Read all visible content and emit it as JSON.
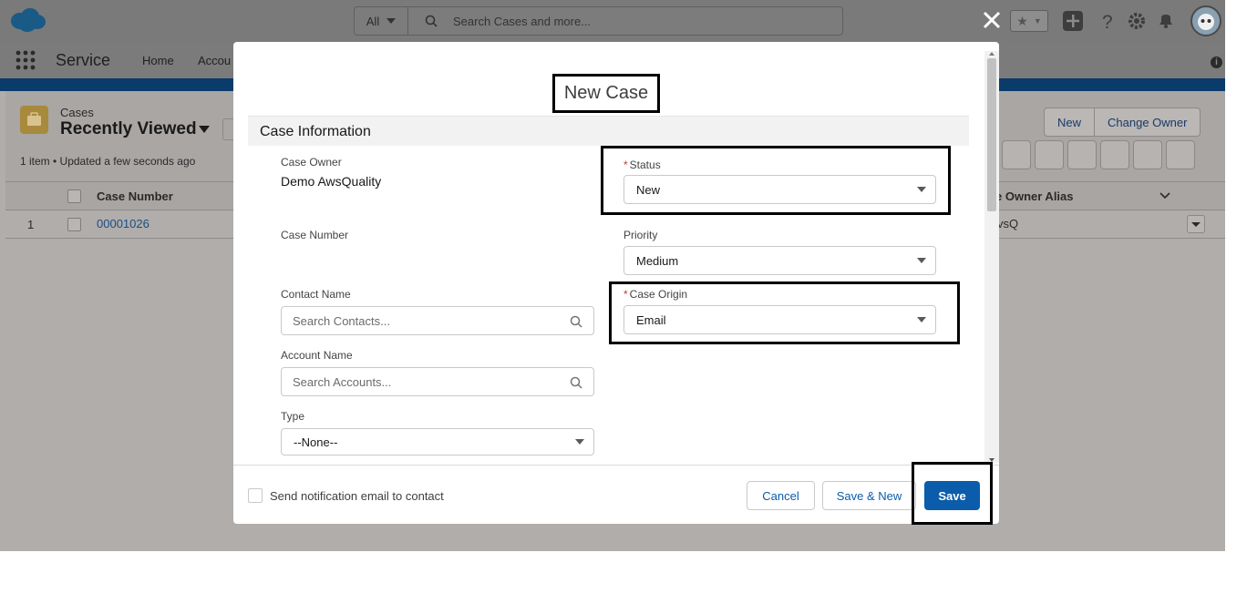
{
  "header": {
    "search_scope": "All",
    "search_placeholder": "Search Cases and more..."
  },
  "nav": {
    "app_name": "Service",
    "tabs": [
      "Home",
      "Accou"
    ]
  },
  "list": {
    "object_label": "Cases",
    "view_name": "Recently Viewed",
    "updated_text": "1 item • Updated a few seconds ago",
    "buttons": [
      "New",
      "Change Owner"
    ],
    "columns": {
      "case_number": "Case Number",
      "owner_alias": "e Owner Alias"
    },
    "rows": [
      {
        "index": "1",
        "case_number": "00001026",
        "owner_alias": "vsQ"
      }
    ]
  },
  "modal": {
    "title": "New Case",
    "section": "Case Information",
    "fields": {
      "case_owner": {
        "label": "Case Owner",
        "value": "Demo AwsQuality"
      },
      "status": {
        "label": "Status",
        "required_mark": "*",
        "value": "New"
      },
      "case_number": {
        "label": "Case Number"
      },
      "priority": {
        "label": "Priority",
        "value": "Medium"
      },
      "contact_name": {
        "label": "Contact Name",
        "placeholder": "Search Contacts..."
      },
      "case_origin": {
        "label": "Case Origin",
        "required_mark": "*",
        "value": "Email"
      },
      "account_name": {
        "label": "Account Name",
        "placeholder": "Search Accounts..."
      },
      "type": {
        "label": "Type",
        "value": "--None--"
      }
    },
    "footer": {
      "notify_label": "Send notification email to contact",
      "cancel": "Cancel",
      "save_new": "Save & New",
      "save": "Save"
    }
  },
  "colors": {
    "brand": "#0b5cab",
    "link": "#1b5aa0",
    "required": "#c23934",
    "highlight": "#000000"
  }
}
